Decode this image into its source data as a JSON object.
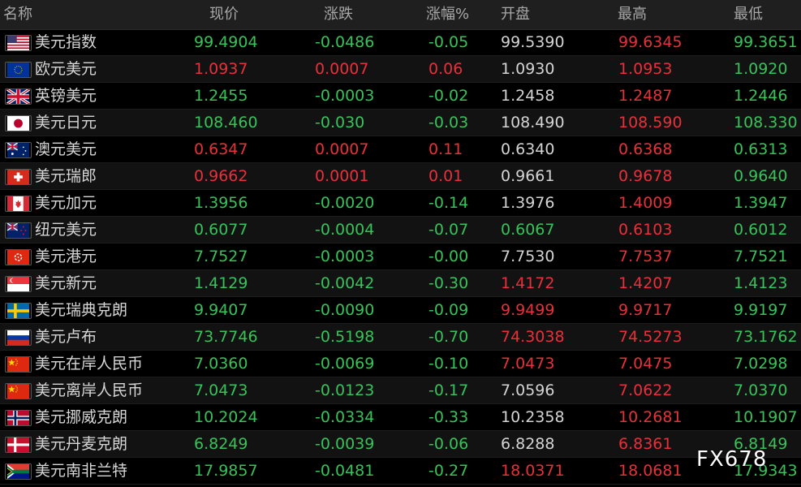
{
  "columns": {
    "name": "名称",
    "price": "现价",
    "change": "涨跌",
    "change_pct": "涨幅%",
    "open": "开盘",
    "high": "最高",
    "low": "最低"
  },
  "colors": {
    "up": "#e8303a",
    "down": "#38c25a",
    "flat": "#d4d4d4"
  },
  "rows": [
    {
      "name": "美元指数",
      "flag": "us",
      "price": "99.4904",
      "change": "-0.0486",
      "change_pct": "-0.05",
      "open": "99.5390",
      "high": "99.6345",
      "low": "99.3651",
      "c": [
        "down",
        "down",
        "down",
        "flat",
        "up",
        "down"
      ]
    },
    {
      "name": "欧元美元",
      "flag": "eu",
      "price": "1.0937",
      "change": "0.0007",
      "change_pct": "0.06",
      "open": "1.0930",
      "high": "1.0953",
      "low": "1.0920",
      "c": [
        "up",
        "up",
        "up",
        "flat",
        "up",
        "down"
      ]
    },
    {
      "name": "英镑美元",
      "flag": "gb",
      "price": "1.2455",
      "change": "-0.0003",
      "change_pct": "-0.02",
      "open": "1.2458",
      "high": "1.2487",
      "low": "1.2446",
      "c": [
        "down",
        "down",
        "down",
        "flat",
        "up",
        "down"
      ]
    },
    {
      "name": "美元日元",
      "flag": "jp",
      "price": "108.460",
      "change": "-0.030",
      "change_pct": "-0.03",
      "open": "108.490",
      "high": "108.590",
      "low": "108.330",
      "c": [
        "down",
        "down",
        "down",
        "flat",
        "up",
        "down"
      ]
    },
    {
      "name": "澳元美元",
      "flag": "au",
      "price": "0.6347",
      "change": "0.0007",
      "change_pct": "0.11",
      "open": "0.6340",
      "high": "0.6368",
      "low": "0.6313",
      "c": [
        "up",
        "up",
        "up",
        "flat",
        "up",
        "down"
      ]
    },
    {
      "name": "美元瑞郎",
      "flag": "ch",
      "price": "0.9662",
      "change": "0.0001",
      "change_pct": "0.01",
      "open": "0.9661",
      "high": "0.9678",
      "low": "0.9640",
      "c": [
        "up",
        "up",
        "up",
        "flat",
        "up",
        "down"
      ]
    },
    {
      "name": "美元加元",
      "flag": "ca",
      "price": "1.3956",
      "change": "-0.0020",
      "change_pct": "-0.14",
      "open": "1.3976",
      "high": "1.4009",
      "low": "1.3947",
      "c": [
        "down",
        "down",
        "down",
        "flat",
        "up",
        "down"
      ]
    },
    {
      "name": "纽元美元",
      "flag": "nz",
      "price": "0.6077",
      "change": "-0.0004",
      "change_pct": "-0.07",
      "open": "0.6067",
      "high": "0.6103",
      "low": "0.6012",
      "c": [
        "down",
        "down",
        "down",
        "down",
        "up",
        "down"
      ]
    },
    {
      "name": "美元港元",
      "flag": "hk",
      "price": "7.7527",
      "change": "-0.0003",
      "change_pct": "-0.00",
      "open": "7.7530",
      "high": "7.7537",
      "low": "7.7521",
      "c": [
        "down",
        "down",
        "down",
        "flat",
        "up",
        "down"
      ]
    },
    {
      "name": "美元新元",
      "flag": "sg",
      "price": "1.4129",
      "change": "-0.0042",
      "change_pct": "-0.30",
      "open": "1.4172",
      "high": "1.4207",
      "low": "1.4123",
      "c": [
        "down",
        "down",
        "down",
        "up",
        "up",
        "down"
      ]
    },
    {
      "name": "美元瑞典克朗",
      "flag": "se",
      "price": "9.9407",
      "change": "-0.0090",
      "change_pct": "-0.09",
      "open": "9.9499",
      "high": "9.9717",
      "low": "9.9197",
      "c": [
        "down",
        "down",
        "down",
        "up",
        "up",
        "down"
      ]
    },
    {
      "name": "美元卢布",
      "flag": "ru",
      "price": "73.7746",
      "change": "-0.5198",
      "change_pct": "-0.70",
      "open": "74.3038",
      "high": "74.5273",
      "low": "73.1762",
      "c": [
        "down",
        "down",
        "down",
        "up",
        "up",
        "down"
      ]
    },
    {
      "name": "美元在岸人民币",
      "flag": "cn",
      "price": "7.0360",
      "change": "-0.0069",
      "change_pct": "-0.10",
      "open": "7.0473",
      "high": "7.0475",
      "low": "7.0298",
      "c": [
        "down",
        "down",
        "down",
        "up",
        "up",
        "down"
      ]
    },
    {
      "name": "美元离岸人民币",
      "flag": "cn",
      "price": "7.0473",
      "change": "-0.0123",
      "change_pct": "-0.17",
      "open": "7.0596",
      "high": "7.0622",
      "low": "7.0370",
      "c": [
        "down",
        "down",
        "down",
        "flat",
        "up",
        "down"
      ]
    },
    {
      "name": "美元挪威克朗",
      "flag": "no",
      "price": "10.2024",
      "change": "-0.0334",
      "change_pct": "-0.33",
      "open": "10.2358",
      "high": "10.2681",
      "low": "10.1907",
      "c": [
        "down",
        "down",
        "down",
        "flat",
        "up",
        "down"
      ]
    },
    {
      "name": "美元丹麦克朗",
      "flag": "dk",
      "price": "6.8249",
      "change": "-0.0039",
      "change_pct": "-0.06",
      "open": "6.8288",
      "high": "6.8361",
      "low": "6.8149",
      "c": [
        "down",
        "down",
        "down",
        "flat",
        "up",
        "down"
      ]
    },
    {
      "name": "美元南非兰特",
      "flag": "za",
      "price": "17.9857",
      "change": "-0.0481",
      "change_pct": "-0.27",
      "open": "18.0371",
      "high": "18.0681",
      "low": "17.9343",
      "c": [
        "down",
        "down",
        "down",
        "up",
        "up",
        "down"
      ]
    }
  ],
  "watermark": "FX678"
}
